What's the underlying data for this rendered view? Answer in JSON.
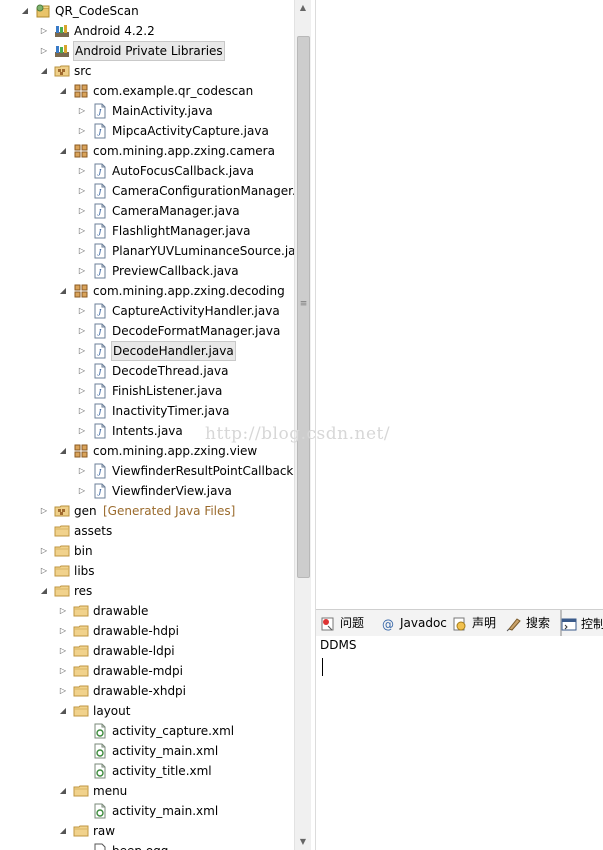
{
  "tree": {
    "items": [
      {
        "label": "QR_CodeScan",
        "icon": "project-icon",
        "twisty": "expanded",
        "depth": 0
      },
      {
        "label": "Android 4.2.2",
        "icon": "library-icon",
        "twisty": "collapsed",
        "depth": 1
      },
      {
        "label": "Android Private Libraries",
        "icon": "library-icon",
        "twisty": "collapsed",
        "depth": 1,
        "selected": true
      },
      {
        "label": "src",
        "icon": "source-folder-icon",
        "twisty": "expanded",
        "depth": 1
      },
      {
        "label": "com.example.qr_codescan",
        "icon": "package-icon",
        "twisty": "expanded",
        "depth": 2
      },
      {
        "label": "MainActivity.java",
        "icon": "java-file-icon",
        "twisty": "collapsed",
        "depth": 3
      },
      {
        "label": "MipcaActivityCapture.java",
        "icon": "java-file-icon",
        "twisty": "collapsed",
        "depth": 3
      },
      {
        "label": "com.mining.app.zxing.camera",
        "icon": "package-icon",
        "twisty": "expanded",
        "depth": 2
      },
      {
        "label": "AutoFocusCallback.java",
        "icon": "java-file-icon",
        "twisty": "collapsed",
        "depth": 3
      },
      {
        "label": "CameraConfigurationManager.java",
        "icon": "java-file-icon",
        "twisty": "collapsed",
        "depth": 3
      },
      {
        "label": "CameraManager.java",
        "icon": "java-file-icon",
        "twisty": "collapsed",
        "depth": 3
      },
      {
        "label": "FlashlightManager.java",
        "icon": "java-file-icon",
        "twisty": "collapsed",
        "depth": 3
      },
      {
        "label": "PlanarYUVLuminanceSource.java",
        "icon": "java-file-icon",
        "twisty": "collapsed",
        "depth": 3
      },
      {
        "label": "PreviewCallback.java",
        "icon": "java-file-icon",
        "twisty": "collapsed",
        "depth": 3
      },
      {
        "label": "com.mining.app.zxing.decoding",
        "icon": "package-icon",
        "twisty": "expanded",
        "depth": 2
      },
      {
        "label": "CaptureActivityHandler.java",
        "icon": "java-file-icon",
        "twisty": "collapsed",
        "depth": 3
      },
      {
        "label": "DecodeFormatManager.java",
        "icon": "java-file-icon",
        "twisty": "collapsed",
        "depth": 3
      },
      {
        "label": "DecodeHandler.java",
        "icon": "java-file-icon",
        "twisty": "collapsed",
        "depth": 3,
        "selected": true
      },
      {
        "label": "DecodeThread.java",
        "icon": "java-file-icon",
        "twisty": "collapsed",
        "depth": 3
      },
      {
        "label": "FinishListener.java",
        "icon": "java-file-icon",
        "twisty": "collapsed",
        "depth": 3
      },
      {
        "label": "InactivityTimer.java",
        "icon": "java-file-icon",
        "twisty": "collapsed",
        "depth": 3
      },
      {
        "label": "Intents.java",
        "icon": "java-file-icon",
        "twisty": "collapsed",
        "depth": 3
      },
      {
        "label": "com.mining.app.zxing.view",
        "icon": "package-icon",
        "twisty": "expanded",
        "depth": 2
      },
      {
        "label": "ViewfinderResultPointCallback.java",
        "icon": "java-file-icon",
        "twisty": "collapsed",
        "depth": 3
      },
      {
        "label": "ViewfinderView.java",
        "icon": "java-file-icon",
        "twisty": "collapsed",
        "depth": 3
      },
      {
        "label": "gen",
        "decoration": "[Generated Java Files]",
        "icon": "source-folder-icon",
        "twisty": "collapsed",
        "depth": 1
      },
      {
        "label": "assets",
        "icon": "folder-icon",
        "twisty": "none",
        "depth": 1
      },
      {
        "label": "bin",
        "icon": "folder-icon",
        "twisty": "collapsed",
        "depth": 1
      },
      {
        "label": "libs",
        "icon": "folder-icon",
        "twisty": "collapsed",
        "depth": 1
      },
      {
        "label": "res",
        "icon": "folder-icon",
        "twisty": "expanded",
        "depth": 1
      },
      {
        "label": "drawable",
        "icon": "folder-icon",
        "twisty": "collapsed",
        "depth": 2
      },
      {
        "label": "drawable-hdpi",
        "icon": "folder-icon",
        "twisty": "collapsed",
        "depth": 2
      },
      {
        "label": "drawable-ldpi",
        "icon": "folder-icon",
        "twisty": "collapsed",
        "depth": 2
      },
      {
        "label": "drawable-mdpi",
        "icon": "folder-icon",
        "twisty": "collapsed",
        "depth": 2
      },
      {
        "label": "drawable-xhdpi",
        "icon": "folder-icon",
        "twisty": "collapsed",
        "depth": 2
      },
      {
        "label": "layout",
        "icon": "folder-icon",
        "twisty": "expanded",
        "depth": 2
      },
      {
        "label": "activity_capture.xml",
        "icon": "xml-file-icon",
        "twisty": "none",
        "depth": 3
      },
      {
        "label": "activity_main.xml",
        "icon": "xml-file-icon",
        "twisty": "none",
        "depth": 3
      },
      {
        "label": "activity_title.xml",
        "icon": "xml-file-icon",
        "twisty": "none",
        "depth": 3
      },
      {
        "label": "menu",
        "icon": "folder-icon",
        "twisty": "expanded",
        "depth": 2
      },
      {
        "label": "activity_main.xml",
        "icon": "xml-file-icon",
        "twisty": "none",
        "depth": 3
      },
      {
        "label": "raw",
        "icon": "folder-icon",
        "twisty": "expanded",
        "depth": 2
      },
      {
        "label": "beep.ogg",
        "icon": "file-icon",
        "twisty": "none",
        "depth": 3
      }
    ]
  },
  "bottom_panel": {
    "tabs": [
      {
        "label": "问题",
        "icon": "problems-icon"
      },
      {
        "label": "Javadoc",
        "icon": "javadoc-icon"
      },
      {
        "label": "声明",
        "icon": "declaration-icon"
      },
      {
        "label": "搜索",
        "icon": "search-icon"
      },
      {
        "label": "控制",
        "icon": "console-icon",
        "active": true
      }
    ],
    "console_title": "DDMS"
  },
  "watermark": "http://blog.csdn.net/",
  "colors": {
    "decoration": "#9a6a2c",
    "selection": "#e8e8e8"
  }
}
